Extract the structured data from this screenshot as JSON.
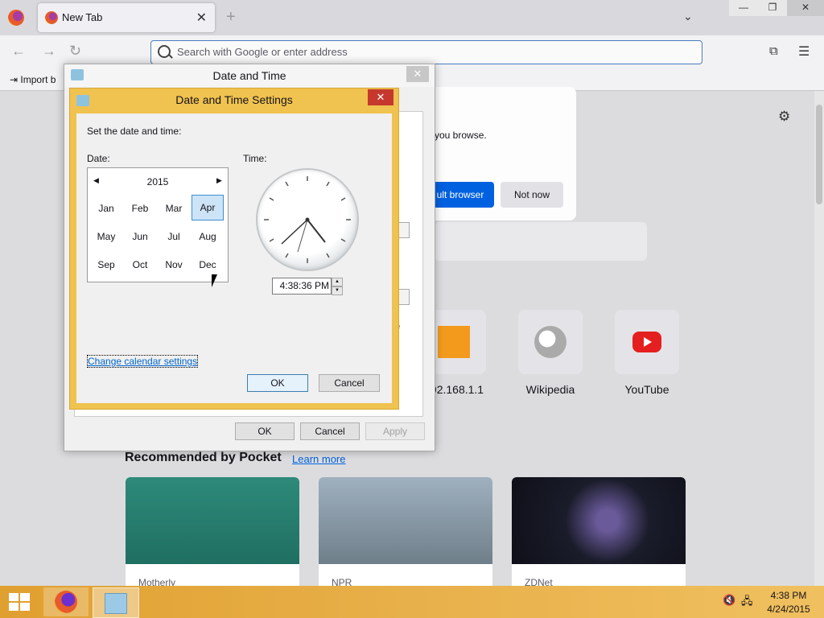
{
  "browser": {
    "tab_label": "New Tab",
    "address_placeholder": "Search with Google or enter address",
    "bookmark_import": "Import b"
  },
  "newtab": {
    "default_msg": "you browse.",
    "default_button": "ult browser",
    "notnow_button": "Not now",
    "shortcuts": [
      {
        "label": "92.168.1.1",
        "icon": "router-icon"
      },
      {
        "label": "Wikipedia",
        "icon": "wikipedia-icon"
      },
      {
        "label": "YouTube",
        "icon": "youtube-icon"
      }
    ],
    "pocket_title": "Recommended by Pocket",
    "pocket_learn": "Learn more",
    "cards": [
      {
        "source": "Motherly"
      },
      {
        "source": "NPR"
      },
      {
        "source": "ZDNet"
      }
    ]
  },
  "outer_dialog": {
    "title": "Date and Time",
    "close": "✕",
    "ok": "OK",
    "cancel": "Cancel",
    "apply": "Apply",
    "ghost_char": "e"
  },
  "settings_dialog": {
    "title": "Date and Time Settings",
    "close": "✕",
    "prompt": "Set the date and time:",
    "date_label": "Date:",
    "time_label": "Time:",
    "year": "2015",
    "months": [
      "Jan",
      "Feb",
      "Mar",
      "Apr",
      "May",
      "Jun",
      "Jul",
      "Aug",
      "Sep",
      "Oct",
      "Nov",
      "Dec"
    ],
    "selected_month": "Apr",
    "time_value": "4:38:36 PM",
    "calendar_link": "Change calendar settings",
    "ok": "OK",
    "cancel": "Cancel"
  },
  "taskbar": {
    "time": "4:38 PM",
    "date": "4/24/2015"
  },
  "colors": {
    "dialog_accent": "#f0c24f",
    "close_red": "#c6382e",
    "primary_blue": "#0061e0"
  }
}
